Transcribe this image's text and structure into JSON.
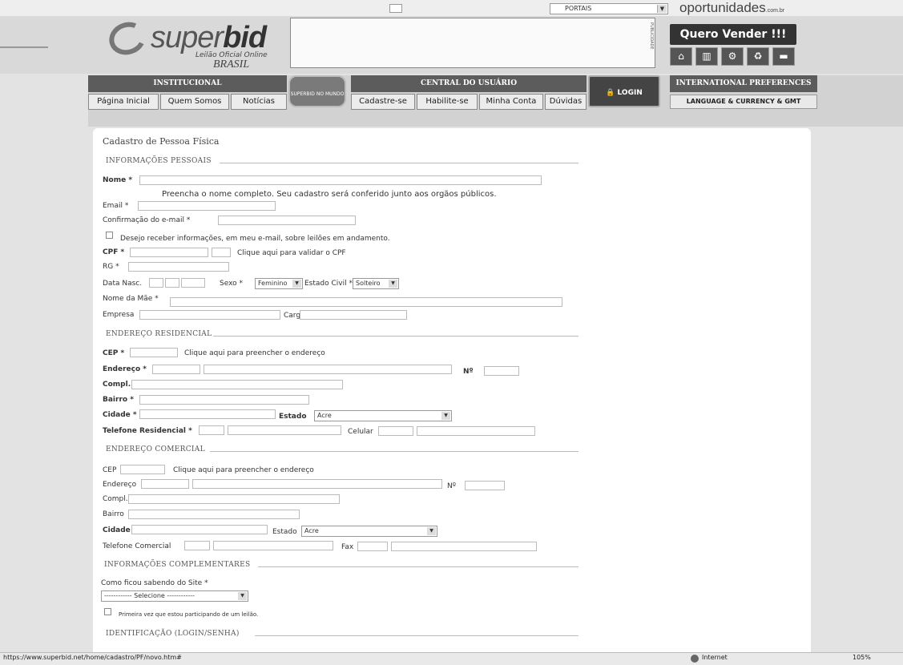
{
  "top": {
    "portais_select": "PORTAIS",
    "brand_right": "oportunidades",
    "brand_right_suffix": ".com.br"
  },
  "logo": {
    "name_light": "super",
    "name_bold": "bid",
    "tagline": "Leilão Oficial Online",
    "country": "BRASIL"
  },
  "ad_tag": "PUBLICIDADE",
  "sell_button": "Quero Vender !!!",
  "category_icons": [
    "home-icon",
    "factory-icon",
    "motorcycle-icon",
    "recycle-icon",
    "car-icon"
  ],
  "nav": {
    "institucional": "INSTITUCIONAL",
    "links_inst": [
      "Página Inicial",
      "Quem Somos",
      "Notícias"
    ],
    "superbid_mundo": "SUPERBID NO MUNDO",
    "central": "CENTRAL DO USUÁRIO",
    "links_central": [
      "Cadastre-se",
      "Habilite-se",
      "Minha Conta",
      "Dúvidas"
    ],
    "login": "LOGIN",
    "international": "INTERNATIONAL PREFERENCES",
    "language": "LANGUAGE & CURRENCY & GMT"
  },
  "form": {
    "title": "Cadastro de Pessoa Física",
    "sections": {
      "pessoais": "INFORMAÇÕES PESSOAIS",
      "residencial": "ENDEREÇO RESIDENCIAL",
      "comercial": "ENDEREÇO COMERCIAL",
      "complementares": "INFORMAÇÕES COMPLEMENTARES",
      "identificacao": "IDENTIFICAÇÃO (LOGIN/SENHA)"
    },
    "labels": {
      "nome": "Nome *",
      "nome_hint": "Preencha o nome completo. Seu cadastro será conferido junto aos orgãos públicos.",
      "email": "Email *",
      "conf_email": "Confirmação do e-mail *",
      "newsletter": "Desejo receber informações, em meu e-mail, sobre leilões em andamento.",
      "cpf": "CPF *",
      "cpf_link": "Clique aqui para validar o CPF",
      "rg": "RG *",
      "data_nasc": "Data Nasc.",
      "sexo": "Sexo *",
      "estado_civil": "Estado Civil *",
      "nome_mae": "Nome da Mãe *",
      "empresa": "Empresa",
      "cargo": "Cargo",
      "cep_res": "CEP *",
      "cep_link_res": "Clique aqui para preencher o endereço",
      "endereco_res": "Endereço *",
      "numero": "Nº",
      "compl": "Compl.",
      "bairro_res": "Bairro *",
      "cidade_res": "Cidade *",
      "estado": "Estado",
      "telefone_res": "Telefone Residencial *",
      "celular": "Celular",
      "cep_com": "CEP",
      "cep_link_com": "Clique aqui para preencher o endereço",
      "endereco_com": "Endereço",
      "bairro_com": "Bairro",
      "cidade_com": "Cidade",
      "telefone_com": "Telefone Comercial",
      "fax": "Fax",
      "como_soube": "Como ficou sabendo do Site *",
      "primeira_vez": "Primeira vez que estou participando de um leilão."
    },
    "values": {
      "sexo": "Feminino",
      "estado_civil": "Solteiro",
      "estado_res": "Acre",
      "estado_com": "Acre",
      "como_soube": "------------ Selecione ------------"
    }
  },
  "status": {
    "url": "https://www.superbid.net/home/cadastro/PF/novo.htm#",
    "zone": "Internet",
    "zoom": "105%"
  }
}
